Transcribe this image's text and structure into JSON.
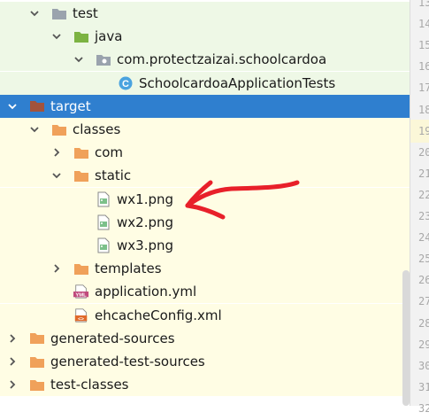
{
  "tree": {
    "rows": [
      {
        "name": "test-folder",
        "label": "test",
        "expanded": true,
        "indent": 0,
        "icon": "folder-gray-icon",
        "bg": "green"
      },
      {
        "name": "java-folder",
        "label": "java",
        "expanded": true,
        "indent": 1,
        "icon": "folder-green-icon",
        "bg": "green"
      },
      {
        "name": "package-com-protectzaizai-schoolcardoa",
        "label": "com.protectzaizai.schoolcardoa",
        "expanded": true,
        "indent": 2,
        "icon": "package-icon",
        "bg": "green"
      },
      {
        "name": "class-schoolcardoa-application-tests",
        "label": "SchoolcardoaApplicationTests",
        "expanded": null,
        "indent": 3,
        "icon": "java-class-icon",
        "bg": "green"
      },
      {
        "name": "target-folder",
        "label": "target",
        "expanded": true,
        "indent": -1,
        "icon": "folder-brown-icon",
        "bg": "selected"
      },
      {
        "name": "classes-folder",
        "label": "classes",
        "expanded": true,
        "indent": 0,
        "icon": "folder-orange-icon",
        "bg": "yellow"
      },
      {
        "name": "com-folder",
        "label": "com",
        "expanded": false,
        "indent": 1,
        "icon": "folder-orange-icon",
        "bg": "yellow"
      },
      {
        "name": "static-folder",
        "label": "static",
        "expanded": true,
        "indent": 1,
        "icon": "folder-orange-icon",
        "bg": "yellow"
      },
      {
        "name": "file-wx1-png",
        "label": "wx1.png",
        "expanded": null,
        "indent": 2,
        "icon": "image-file-icon",
        "bg": "yellow"
      },
      {
        "name": "file-wx2-png",
        "label": "wx2.png",
        "expanded": null,
        "indent": 2,
        "icon": "image-file-icon",
        "bg": "yellow"
      },
      {
        "name": "file-wx3-png",
        "label": "wx3.png",
        "expanded": null,
        "indent": 2,
        "icon": "image-file-icon",
        "bg": "yellow"
      },
      {
        "name": "templates-folder",
        "label": "templates",
        "expanded": false,
        "indent": 1,
        "icon": "folder-orange-icon",
        "bg": "yellow"
      },
      {
        "name": "file-application-yml",
        "label": "application.yml",
        "expanded": null,
        "indent": 1,
        "icon": "yml-file-icon",
        "bg": "yellow"
      },
      {
        "name": "file-ehcacheconfig-xml",
        "label": "ehcacheConfig.xml",
        "expanded": null,
        "indent": 1,
        "icon": "xml-file-icon",
        "bg": "yellow"
      },
      {
        "name": "generated-sources-folder",
        "label": "generated-sources",
        "expanded": false,
        "indent": -1,
        "icon": "folder-orange-icon",
        "bg": "yellow"
      },
      {
        "name": "generated-test-sources-folder",
        "label": "generated-test-sources",
        "expanded": false,
        "indent": -1,
        "icon": "folder-orange-icon",
        "bg": "yellow"
      },
      {
        "name": "test-classes-folder",
        "label": "test-classes",
        "expanded": false,
        "indent": -1,
        "icon": "folder-orange-icon",
        "bg": "yellow"
      }
    ]
  },
  "gutter": {
    "lines": [
      "13",
      "14",
      "15",
      "16",
      "17",
      "18",
      "19",
      "20",
      "21",
      "22",
      "23",
      "24",
      "25",
      "26",
      "27",
      "28",
      "29",
      "30",
      "31",
      "32"
    ],
    "current": "19"
  },
  "colors": {
    "selection": "#2f7fcf",
    "test_bg": "#eef8e6",
    "excluded_bg": "#fffde4",
    "annotation": "#e8202a"
  }
}
